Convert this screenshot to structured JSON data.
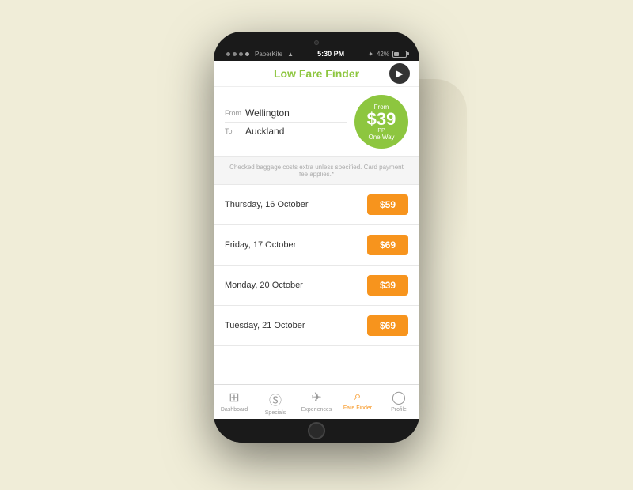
{
  "background": "#f0edd8",
  "phone": {
    "status_bar": {
      "dots": 4,
      "carrier": "PaperKite",
      "wifi": "▲",
      "time": "5:30 PM",
      "bluetooth": "✦",
      "battery_pct": "42%"
    },
    "header": {
      "title": "Low Fare Finder",
      "back_button_icon": "▶"
    },
    "search": {
      "from_label": "From",
      "from_value": "Wellington",
      "to_label": "To",
      "to_value": "Auckland",
      "price_bubble": {
        "from": "From",
        "amount": "$39",
        "pp": "PP",
        "one_way": "One Way"
      }
    },
    "disclaimer": "Checked baggage costs extra unless specified.\nCard payment fee applies.*",
    "fares": [
      {
        "date": "Thursday, 16 October",
        "price": "$59"
      },
      {
        "date": "Friday, 17 October",
        "price": "$69"
      },
      {
        "date": "Monday, 20 October",
        "price": "$39"
      },
      {
        "date": "Tuesday, 21 October",
        "price": "$69"
      }
    ],
    "nav": [
      {
        "label": "Dashboard",
        "icon": "⊞",
        "active": false
      },
      {
        "label": "Specials",
        "icon": "Ⓢ",
        "active": false
      },
      {
        "label": "Experiences",
        "icon": "✈",
        "active": false
      },
      {
        "label": "Fare Finder",
        "icon": "🔍",
        "active": true
      },
      {
        "label": "Profile",
        "icon": "◯",
        "active": false
      }
    ]
  }
}
